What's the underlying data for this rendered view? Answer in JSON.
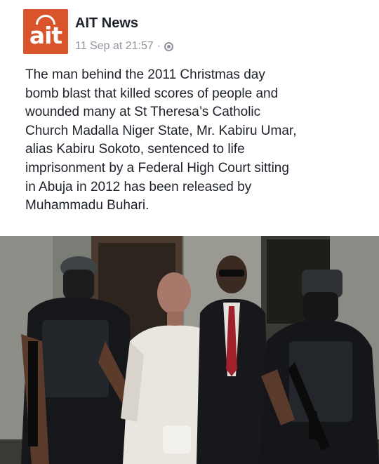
{
  "post": {
    "page_name": "AIT News",
    "logo_text": "ait",
    "timestamp": "11 Sep at 21:57",
    "separator": "·",
    "privacy_icon": "globe-icon",
    "text_lines": [
      "The man behind the 2011 Christmas day",
      "bomb blast that killed scores of people and",
      "wounded many at St Theresa’s Catholic",
      "Church Madalla Niger State, Mr. Kabiru Umar,",
      "alias Kabiru Sokoto, sentenced to life",
      "imprisonment by a Federal High Court sitting",
      "in Abuja in 2012 has been released by",
      "Muhammadu Buhari."
    ]
  },
  "colors": {
    "brand": "#d9542a",
    "name_text": "#1d2129",
    "meta_text": "#90949c"
  }
}
